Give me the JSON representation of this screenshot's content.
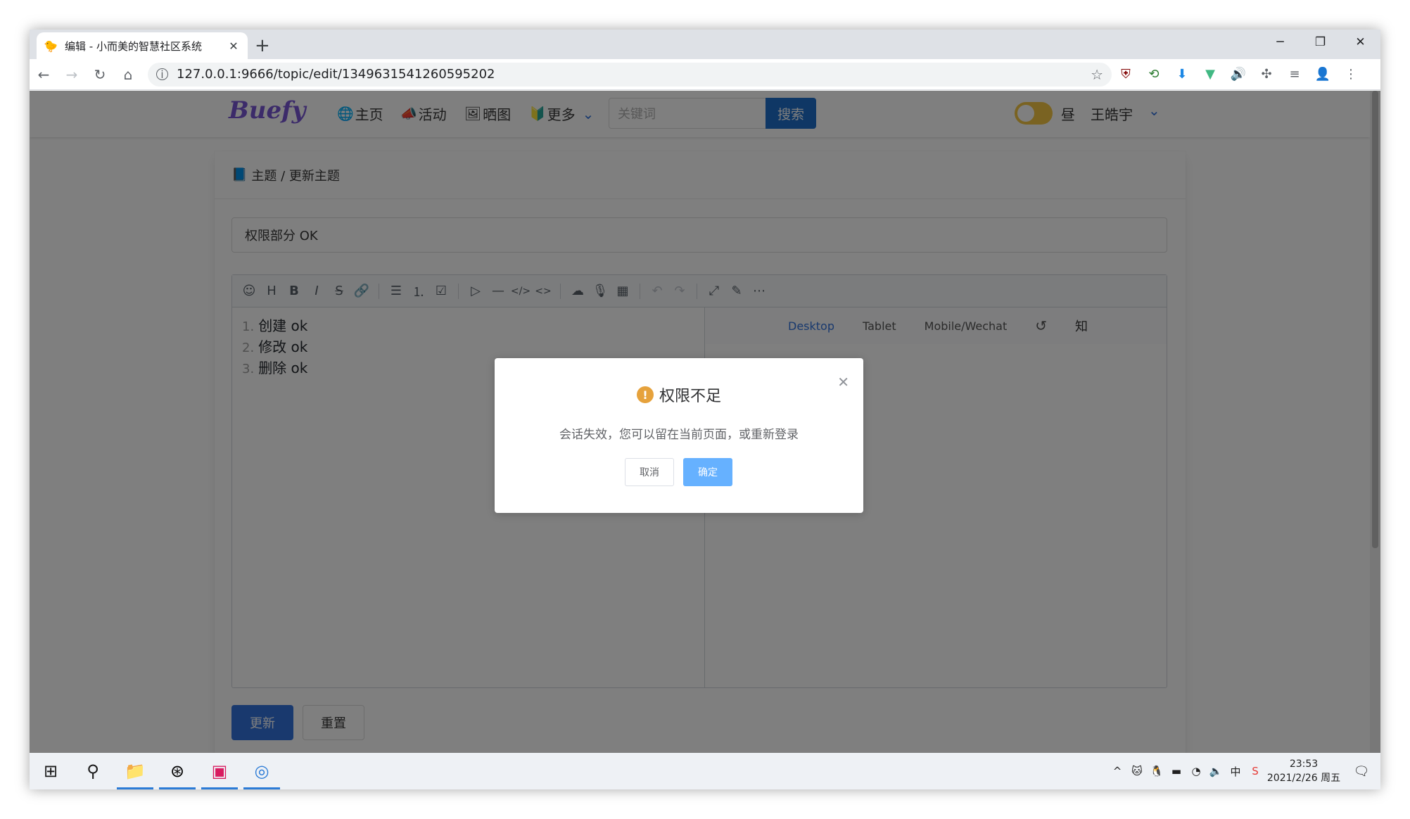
{
  "browser": {
    "tab_title": "编辑 - 小而美的智慧社区系统",
    "tab_close": "✕",
    "new_tab": "+",
    "url": "127.0.0.1:9666/topic/edit/1349631541260595202"
  },
  "nav": {
    "brand": "Buefy",
    "items": [
      {
        "icon": "globe-icon",
        "label": "主页"
      },
      {
        "icon": "megaphone-icon",
        "label": "活动"
      },
      {
        "icon": "picture-icon",
        "label": "晒图"
      },
      {
        "icon": "beginner-badge-icon",
        "label": "更多"
      }
    ],
    "search_placeholder": "关键词",
    "search_button": "搜索",
    "theme_label": "昼",
    "user_name": "王皓宇"
  },
  "page": {
    "breadcrumb": "主题 / 更新主题",
    "title_value": "权限部分 OK",
    "editor_lines": [
      {
        "num": "1.",
        "text": "创建 ok"
      },
      {
        "num": "2.",
        "text": "修改 ok"
      },
      {
        "num": "3.",
        "text": "删除 ok"
      }
    ],
    "preview_tabs": [
      "Desktop",
      "Tablet",
      "Mobile/Wechat"
    ],
    "preview_extra": "知",
    "update_button": "更新",
    "reset_button": "重置"
  },
  "dialog": {
    "title": "权限不足",
    "message": "会话失效，您可以留在当前页面，或重新登录",
    "cancel": "取消",
    "confirm": "确定",
    "warn_mark": "!"
  },
  "taskbar": {
    "time": "23:53",
    "date": "2021/2/26 周五",
    "ime": "中"
  },
  "colors": {
    "primary": "#3273dc",
    "brand": "#7957d5",
    "warning": "#e6a23c",
    "confirm": "#66b1ff"
  }
}
